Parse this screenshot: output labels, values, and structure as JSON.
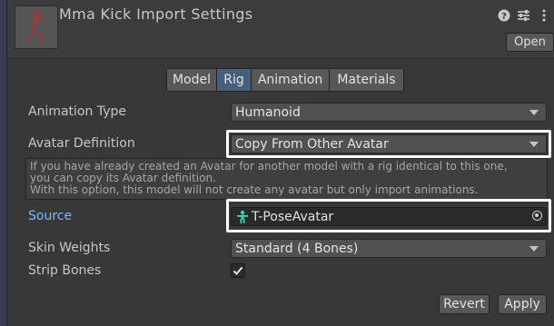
{
  "header": {
    "title": "Mma Kick Import Settings",
    "open_label": "Open",
    "icons": [
      "help-icon",
      "preset-icon",
      "more-menu-icon"
    ]
  },
  "tabs": [
    {
      "label": "Model",
      "active": false
    },
    {
      "label": "Rig",
      "active": true
    },
    {
      "label": "Animation",
      "active": false
    },
    {
      "label": "Materials",
      "active": false
    }
  ],
  "fields": {
    "animation_type": {
      "label": "Animation Type",
      "value": "Humanoid"
    },
    "avatar_definition": {
      "label": "Avatar Definition",
      "value": "Copy From Other Avatar"
    },
    "source": {
      "label": "Source",
      "value": "T-PoseAvatar"
    },
    "skin_weights": {
      "label": "Skin Weights",
      "value": "Standard (4 Bones)"
    },
    "strip_bones": {
      "label": "Strip Bones",
      "checked": true
    }
  },
  "help": {
    "line1": "If you have already created an Avatar for another model with a rig identical to this one,",
    "line2": "you can copy its Avatar definition.",
    "line3": "With this option, this model will not create any avatar but only import animations."
  },
  "footer": {
    "revert_label": "Revert",
    "apply_label": "Apply"
  },
  "colors": {
    "background": "#383838",
    "active_tab": "#46607c",
    "source_label": "#7fb5f4",
    "highlight_border": "#ffffff",
    "avatar_icon": "#3fd1c2"
  }
}
